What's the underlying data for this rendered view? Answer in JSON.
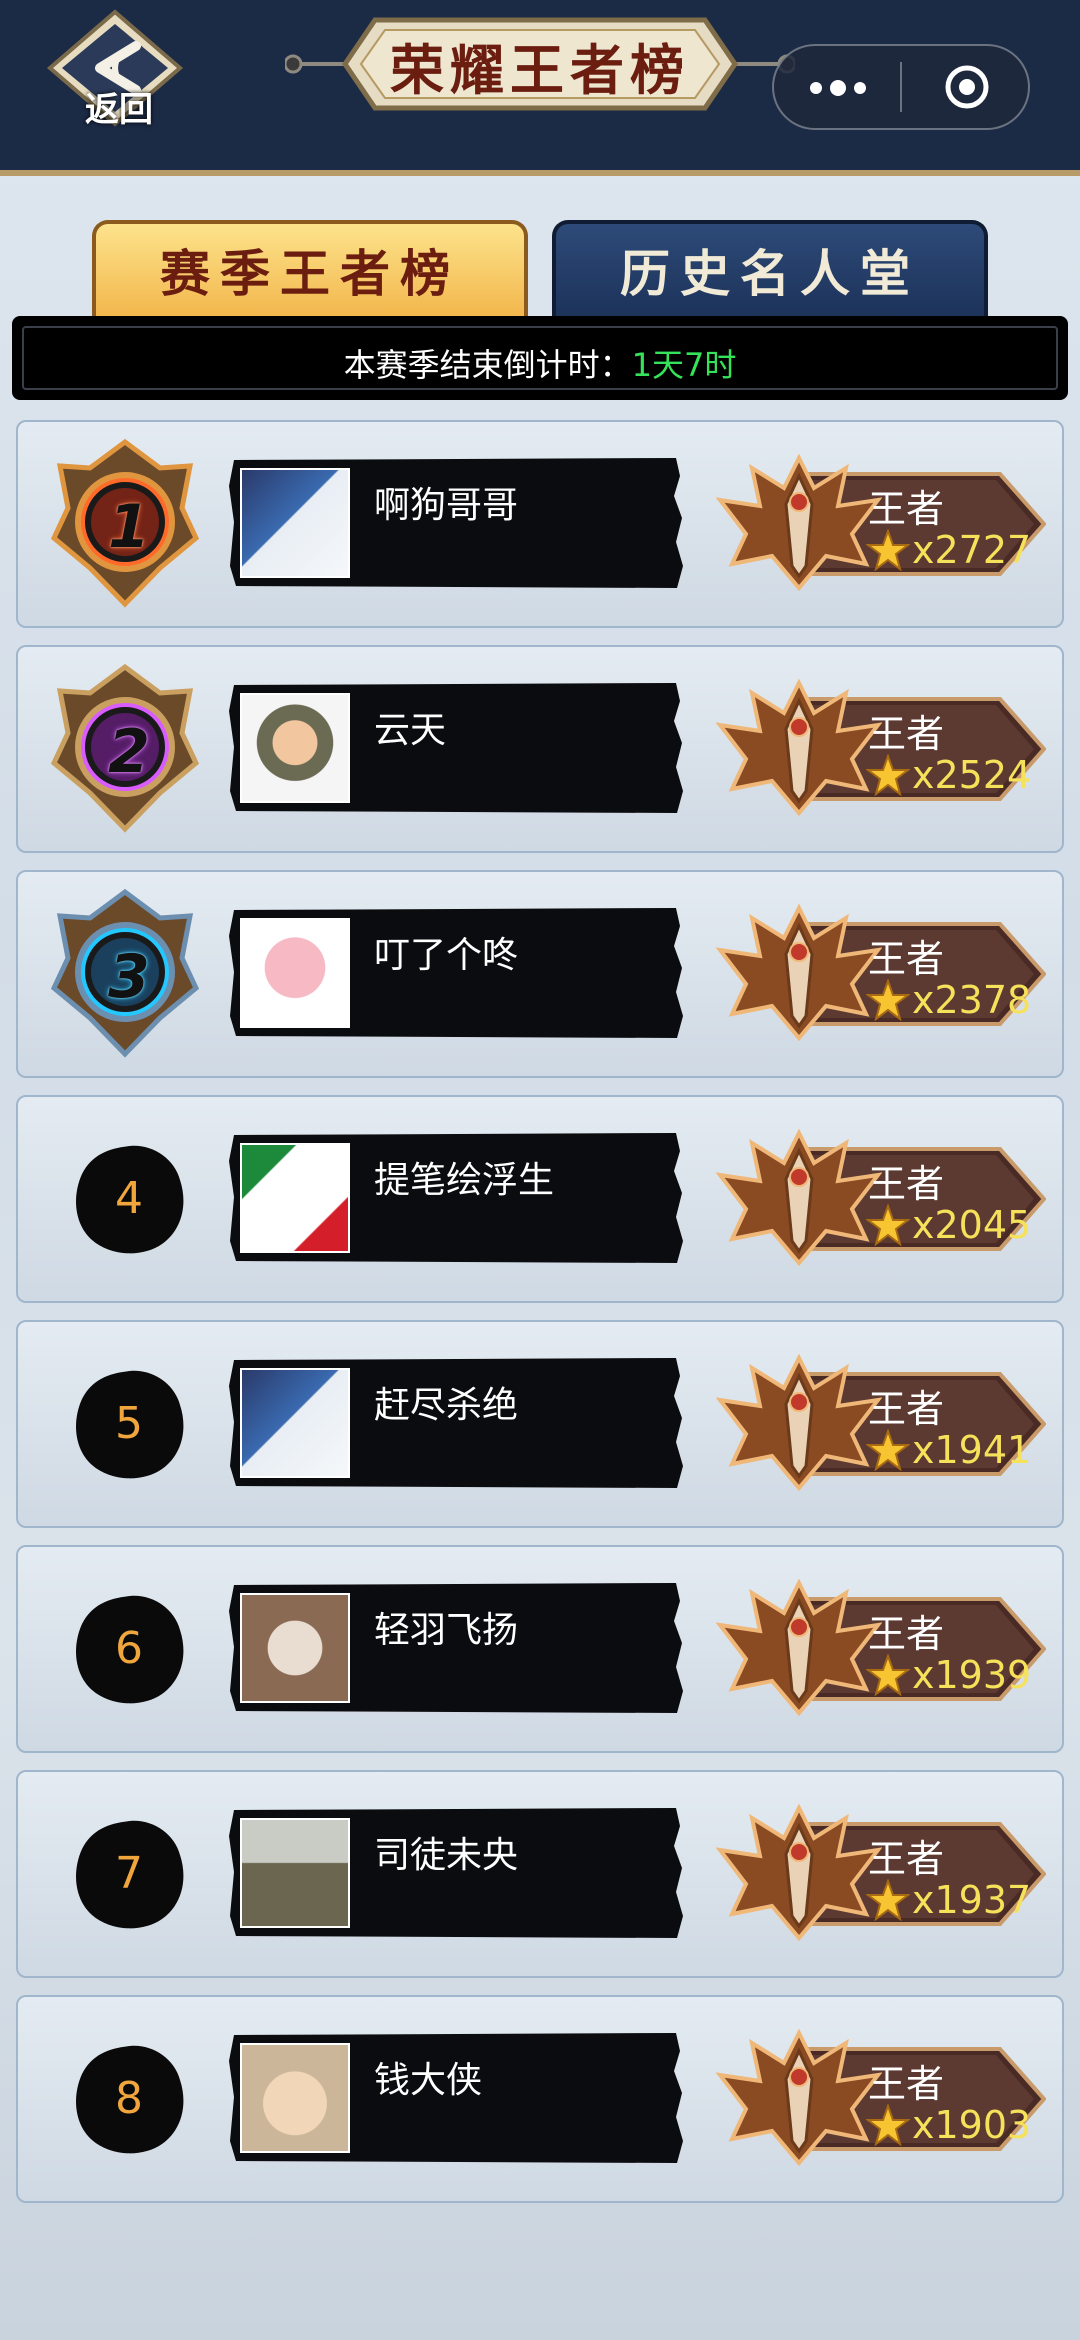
{
  "header": {
    "back_label": "返回",
    "title": "荣耀王者榜"
  },
  "tabs": [
    {
      "label": "赛季王者榜",
      "active": true
    },
    {
      "label": "历史名人堂",
      "active": false
    }
  ],
  "countdown": {
    "label": "本赛季结束倒计时：",
    "value": "1天7时"
  },
  "ranking": [
    {
      "rank": "1",
      "name": "啊狗哥哥",
      "tier": "王者",
      "stars": "x2727"
    },
    {
      "rank": "2",
      "name": "云天",
      "tier": "王者",
      "stars": "x2524"
    },
    {
      "rank": "3",
      "name": "叮了个咚",
      "tier": "王者",
      "stars": "x2378"
    },
    {
      "rank": "4",
      "name": "提笔绘浮生",
      "tier": "王者",
      "stars": "x2045"
    },
    {
      "rank": "5",
      "name": "赶尽杀绝",
      "tier": "王者",
      "stars": "x1941"
    },
    {
      "rank": "6",
      "name": "轻羽飞扬",
      "tier": "王者",
      "stars": "x1939"
    },
    {
      "rank": "7",
      "name": "司徒未央",
      "tier": "王者",
      "stars": "x1937"
    },
    {
      "rank": "8",
      "name": "钱大侠",
      "tier": "王者",
      "stars": "x1903"
    }
  ],
  "colors": {
    "header_bg": "#1b2a45",
    "countdown_value": "#35e35a",
    "star_count": "#f6e15a",
    "rank_number": "#f0a63c"
  },
  "icons": {
    "back": "back-arrow-icon",
    "more": "more-dots-icon",
    "close": "mini-program-close-icon",
    "tier": "king-tier-emblem-icon",
    "star": "star-icon"
  }
}
